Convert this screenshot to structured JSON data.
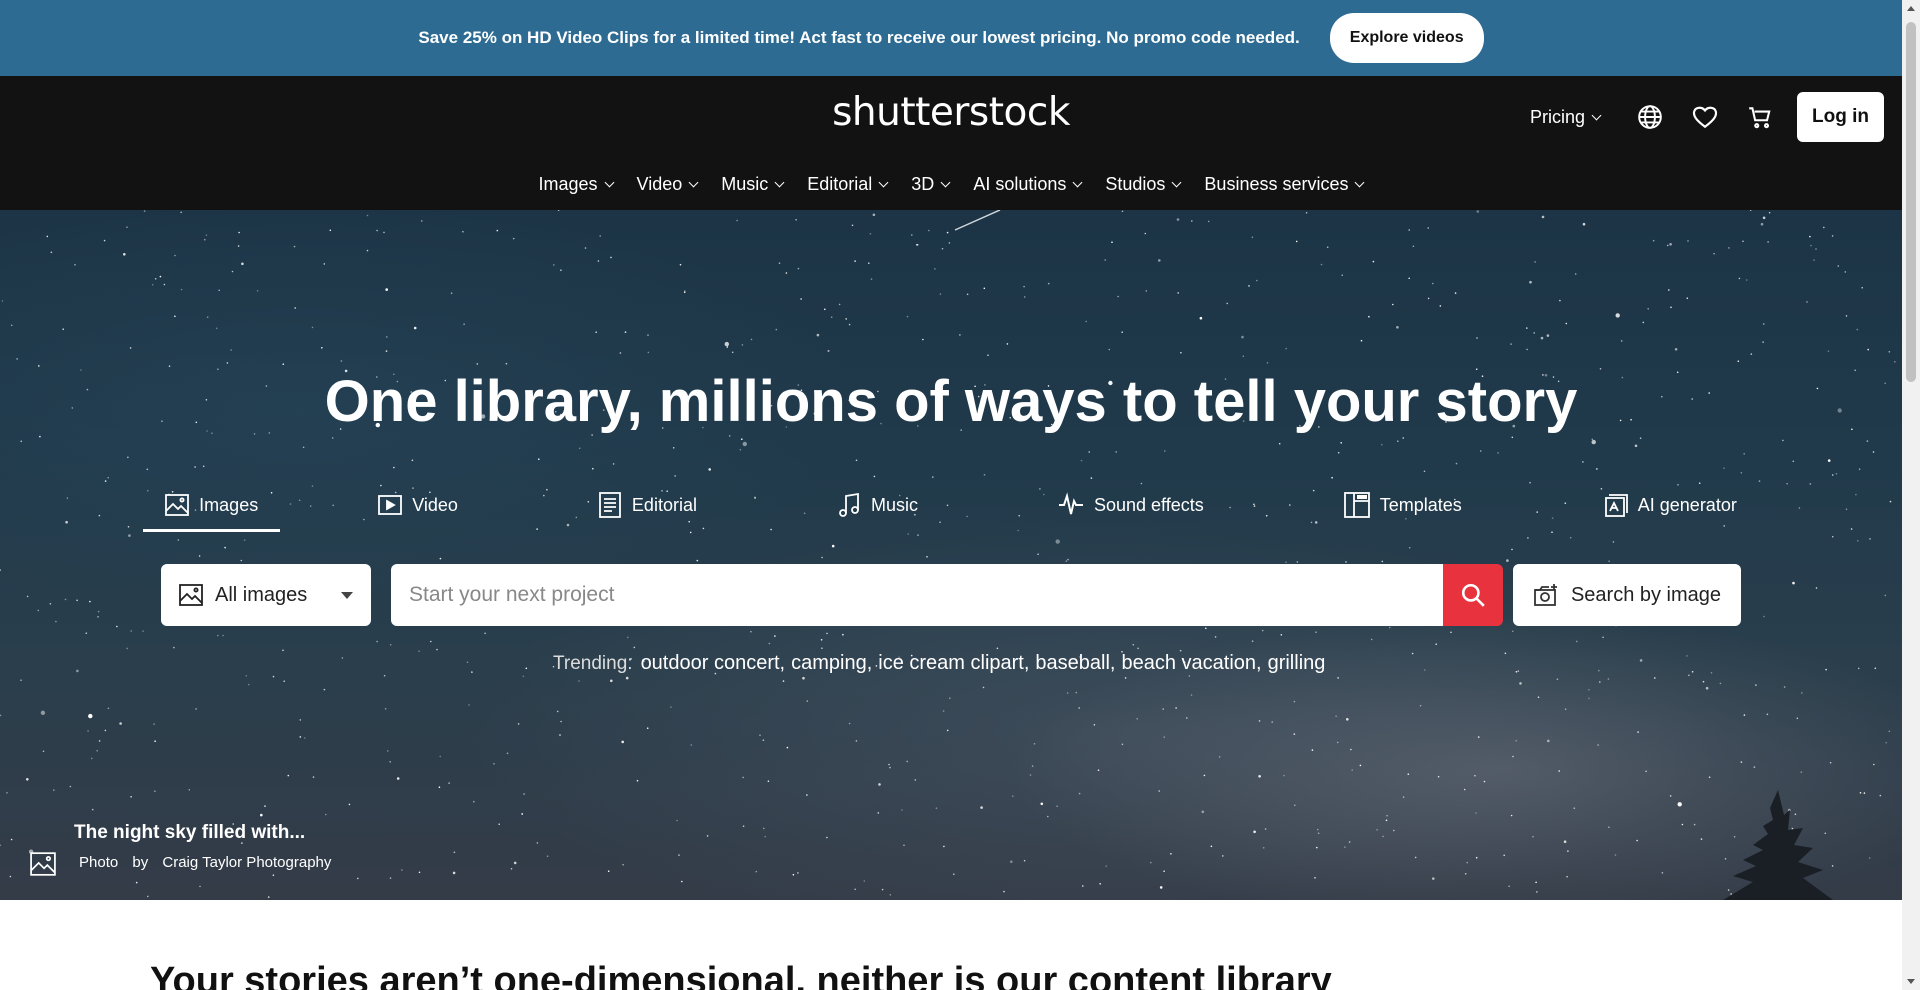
{
  "promo": {
    "text": "Save 25% on HD Video Clips for a limited time! Act fast to receive our lowest pricing. No promo code needed.",
    "button_label": "Explore videos"
  },
  "header": {
    "logo": "shutterstock",
    "pricing_label": "Pricing",
    "login_label": "Log in",
    "icons": [
      "globe-icon",
      "heart-icon",
      "cart-icon"
    ]
  },
  "nav": {
    "items": [
      {
        "label": "Images"
      },
      {
        "label": "Video"
      },
      {
        "label": "Music"
      },
      {
        "label": "Editorial"
      },
      {
        "label": "3D"
      },
      {
        "label": "AI solutions"
      },
      {
        "label": "Studios"
      },
      {
        "label": "Business services"
      }
    ]
  },
  "hero": {
    "title": "One library, millions of ways to tell your story",
    "tabs": [
      {
        "label": "Images",
        "icon": "image-icon",
        "active": true
      },
      {
        "label": "Video",
        "icon": "video-icon"
      },
      {
        "label": "Editorial",
        "icon": "editorial-icon"
      },
      {
        "label": "Music",
        "icon": "music-note-icon"
      },
      {
        "label": "Sound effects",
        "icon": "waveform-icon"
      },
      {
        "label": "Templates",
        "icon": "templates-icon"
      },
      {
        "label": "AI generator",
        "icon": "ai-generator-icon"
      }
    ],
    "search": {
      "type_selected": "All images",
      "placeholder": "Start your next project",
      "image_search_label": "Search by image"
    },
    "trending": {
      "label": "Trending:",
      "terms": [
        "outdoor concert,",
        "camping,",
        "ice cream clipart,",
        "baseball,",
        "beach vacation,",
        "grilling"
      ]
    },
    "credit": {
      "title": "The night sky filled with...",
      "type": "Photo",
      "by": "by",
      "author": "Craig Taylor Photography"
    }
  },
  "below": {
    "heading": "Your stories aren’t one-dimensional, neither is our content library"
  },
  "colors": {
    "promo_bg": "#2d6b93",
    "header_bg": "#121212",
    "search_button": "#e8333f"
  }
}
